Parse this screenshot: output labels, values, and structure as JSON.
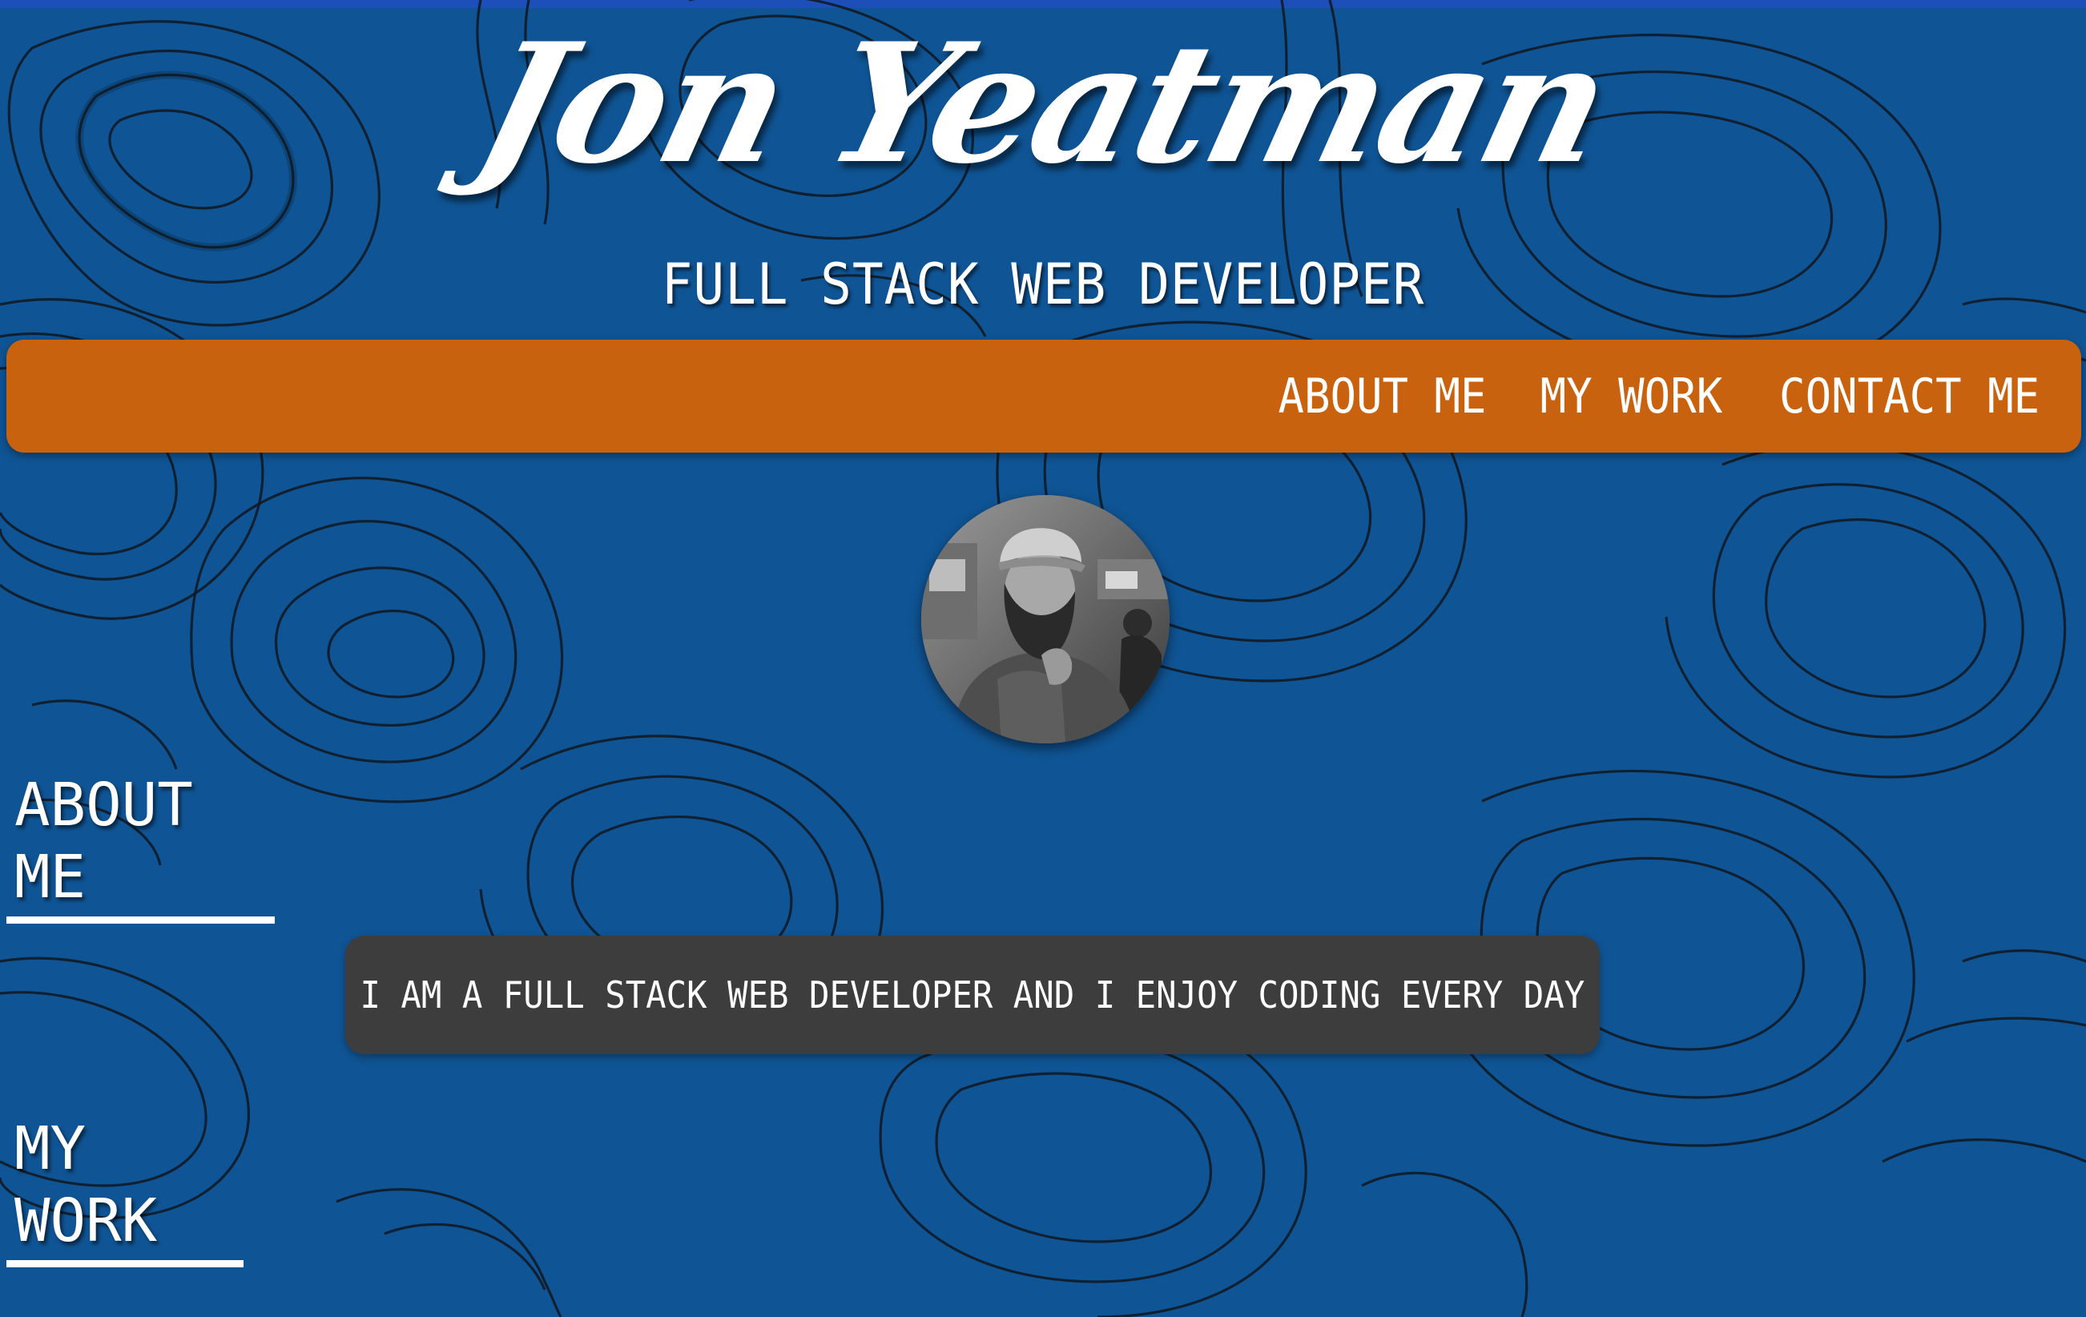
{
  "header": {
    "title": "Jon Yeatman",
    "subtitle": "FULL STACK WEB DEVELOPER"
  },
  "nav": {
    "links": [
      {
        "label": "ABOUT ME"
      },
      {
        "label": "MY WORK"
      },
      {
        "label": "CONTACT ME"
      }
    ]
  },
  "profile": {
    "avatar_alt": "Profile photo"
  },
  "sections": {
    "about": {
      "heading": "ABOUT ME",
      "text": "I AM A FULL STACK WEB DEVELOPER AND I ENJOY CODING EVERY DAY"
    },
    "work": {
      "heading": "MY WORK"
    }
  },
  "colors": {
    "background": "#0f5494",
    "nav": "#c9620f",
    "card": "#3d3d3d",
    "text": "#ffffff"
  },
  "icons": {
    "background": "topographic-contour-pattern"
  }
}
